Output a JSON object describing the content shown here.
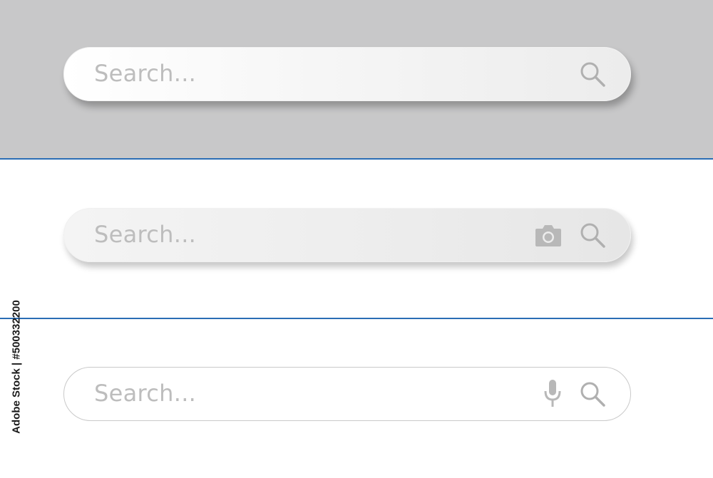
{
  "search_bars": [
    {
      "placeholder": "Search...",
      "icons": [
        "search-icon"
      ]
    },
    {
      "placeholder": "Search...",
      "icons": [
        "camera-icon",
        "search-icon"
      ]
    },
    {
      "placeholder": "Search...",
      "icons": [
        "microphone-icon",
        "search-icon"
      ]
    }
  ],
  "watermark": {
    "id_text": "Adobe Stock | #500332200"
  },
  "colors": {
    "top_background": "#c8c8c9",
    "divider": "#2a6db5",
    "placeholder": "#bdbdbd",
    "icon": "#b0b0b0"
  }
}
